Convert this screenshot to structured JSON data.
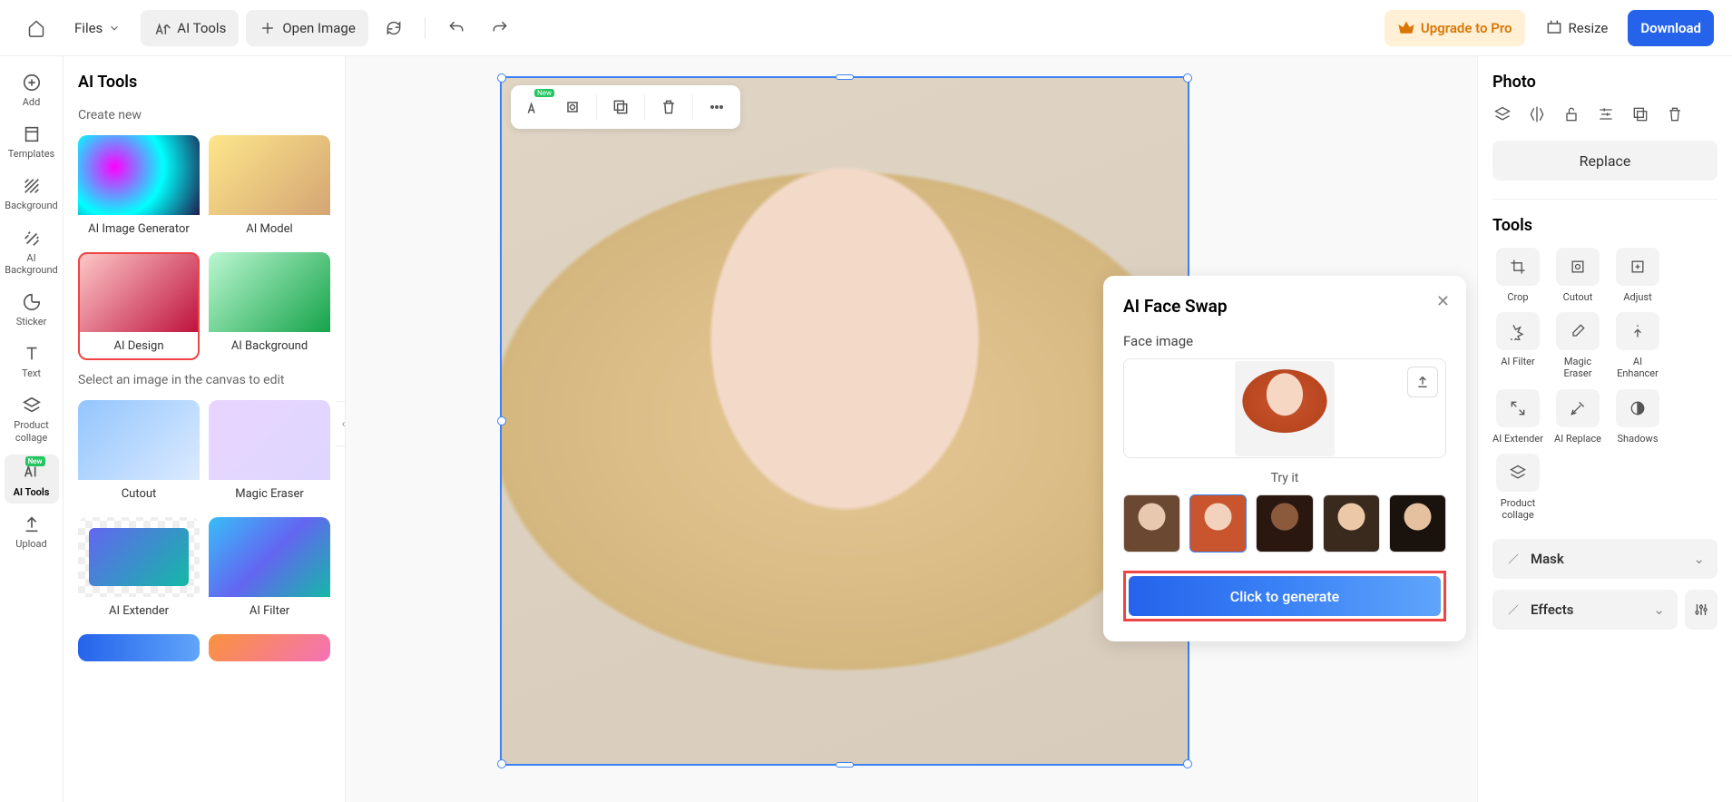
{
  "topbar": {
    "files": "Files",
    "ai_tools": "AI Tools",
    "open_image": "Open Image",
    "upgrade": "Upgrade to Pro",
    "resize": "Resize",
    "download": "Download"
  },
  "leftnav": {
    "add": "Add",
    "templates": "Templates",
    "background": "Background",
    "ai_background": "AI Background",
    "sticker": "Sticker",
    "text": "Text",
    "product_collage": "Product collage",
    "ai_tools": "AI Tools",
    "upload": "Upload",
    "new_badge": "New"
  },
  "panel": {
    "title": "AI Tools",
    "create_new": "Create new",
    "select_hint": "Select an image in the canvas to edit",
    "cards": {
      "ai_image_generator": "AI Image Generator",
      "ai_model": "AI Model",
      "ai_design": "AI Design",
      "ai_background": "AI Background",
      "cutout": "Cutout",
      "magic_eraser": "Magic Eraser",
      "ai_extender": "AI Extender",
      "ai_filter": "AI Filter"
    }
  },
  "float_toolbar": {
    "new_badge": "New"
  },
  "popup": {
    "title": "AI Face Swap",
    "face_image": "Face image",
    "try_it": "Try it",
    "generate": "Click to generate"
  },
  "rightpanel": {
    "photo": "Photo",
    "replace": "Replace",
    "tools_title": "Tools",
    "tools": {
      "crop": "Crop",
      "cutout": "Cutout",
      "adjust": "Adjust",
      "ai_filter": "AI Filter",
      "magic_eraser": "Magic Eraser",
      "ai_enhancer": "AI Enhancer",
      "ai_extender": "AI Extender",
      "ai_replace": "AI Replace",
      "shadows": "Shadows",
      "product_collage": "Product collage"
    },
    "mask": "Mask",
    "effects": "Effects"
  }
}
